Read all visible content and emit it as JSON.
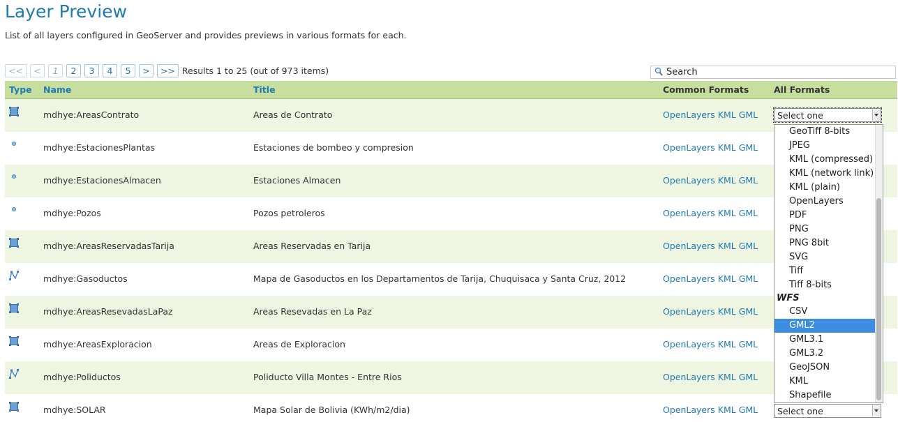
{
  "header": {
    "title": "Layer Preview",
    "subtitle": "List of all layers configured in GeoServer and provides previews in various formats for each."
  },
  "pager": {
    "first": "<<",
    "prev": "<",
    "pages": [
      "1",
      "2",
      "3",
      "4",
      "5"
    ],
    "next": ">",
    "last": ">>",
    "results": "Results 1 to 25 (out of 973 items)"
  },
  "search": {
    "placeholder": "Search"
  },
  "table": {
    "columns": {
      "type": "Type",
      "name": "Name",
      "title": "Title",
      "common": "Common Formats",
      "all": "All Formats"
    },
    "rows": [
      {
        "type_icon": "polygon-icon",
        "name": "mdhye:AreasContrato",
        "title": "Areas de Contrato",
        "formats": [
          "OpenLayers",
          "KML",
          "GML"
        ]
      },
      {
        "type_icon": "point-icon",
        "name": "mdhye:EstacionesPlantas",
        "title": "Estaciones de bombeo y compresion",
        "formats": [
          "OpenLayers",
          "KML",
          "GML"
        ]
      },
      {
        "type_icon": "point-icon",
        "name": "mdhye:EstacionesAlmacen",
        "title": "Estaciones Almacen",
        "formats": [
          "OpenLayers",
          "KML",
          "GML"
        ]
      },
      {
        "type_icon": "point-icon",
        "name": "mdhye:Pozos",
        "title": "Pozos petroleros",
        "formats": [
          "OpenLayers",
          "KML",
          "GML"
        ]
      },
      {
        "type_icon": "polygon-icon",
        "name": "mdhye:AreasReservadasTarija",
        "title": "Areas Reservadas en Tarija",
        "formats": [
          "OpenLayers",
          "KML",
          "GML"
        ]
      },
      {
        "type_icon": "line-icon",
        "name": "mdhye:Gasoductos",
        "title": "Mapa de Gasoductos en los Departamentos de Tarija, Chuquisaca y Santa Cruz, 2012",
        "formats": [
          "OpenLayers",
          "KML",
          "GML"
        ]
      },
      {
        "type_icon": "polygon-icon",
        "name": "mdhye:AreasResevadasLaPaz",
        "title": "Areas Resevadas en La Paz",
        "formats": [
          "OpenLayers",
          "KML",
          "GML"
        ]
      },
      {
        "type_icon": "polygon-icon",
        "name": "mdhye:AreasExploracion",
        "title": "Areas de Exploracion",
        "formats": [
          "OpenLayers",
          "KML",
          "GML"
        ]
      },
      {
        "type_icon": "line-icon",
        "name": "mdhye:Poliductos",
        "title": "Poliducto Villa Montes - Entre Rios",
        "formats": [
          "OpenLayers",
          "KML",
          "GML"
        ]
      },
      {
        "type_icon": "polygon-icon",
        "name": "mdhye:SOLAR",
        "title": "Mapa Solar de Bolivia (KWh/m2/dia)",
        "formats": [
          "OpenLayers",
          "KML",
          "GML"
        ]
      }
    ],
    "select_placeholder": "Select one"
  },
  "dropdown": {
    "wms_items": [
      "GeoTiff 8-bits",
      "JPEG",
      "KML (compressed)",
      "KML (network link)",
      "KML (plain)",
      "OpenLayers",
      "PDF",
      "PNG",
      "PNG 8bit",
      "SVG",
      "Tiff",
      "Tiff 8-bits"
    ],
    "wfs_group": "WFS",
    "wfs_items": [
      "CSV",
      "GML2",
      "GML3.1",
      "GML3.2",
      "GeoJSON",
      "KML",
      "Shapefile"
    ],
    "selected": "GML2"
  },
  "colors": {
    "accent": "#1f7ab3",
    "header_bg": "#c6df9e",
    "row_alt": "#eef5e1",
    "selected": "#3d8ee0"
  }
}
